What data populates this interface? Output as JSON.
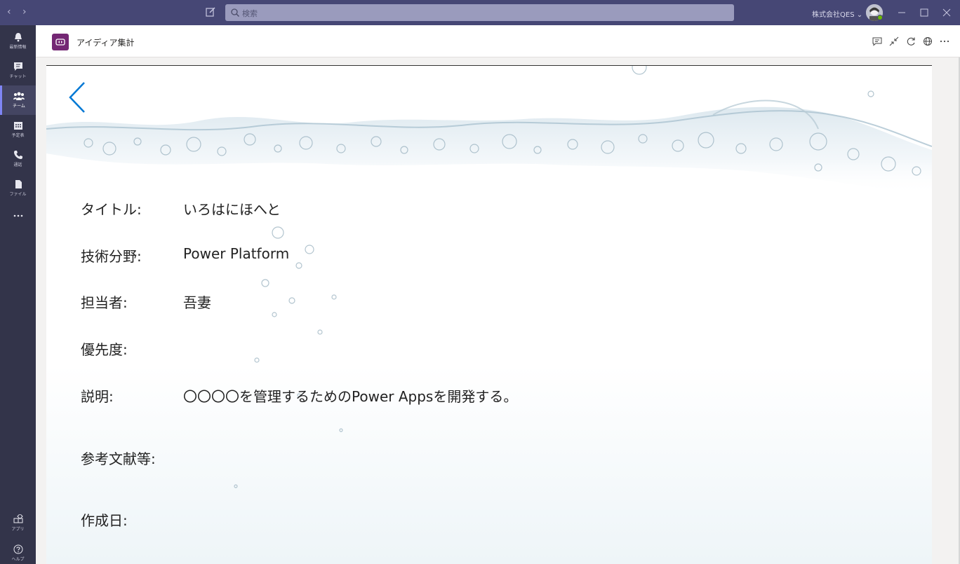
{
  "titlebar": {
    "search_placeholder": "検索",
    "org_name": "株式会社QES"
  },
  "rail": {
    "items": [
      {
        "label": "最新情報",
        "icon": "bell-icon"
      },
      {
        "label": "チャット",
        "icon": "chat-icon"
      },
      {
        "label": "チーム",
        "icon": "teams-icon",
        "active": true
      },
      {
        "label": "予定表",
        "icon": "calendar-icon"
      },
      {
        "label": "通話",
        "icon": "phone-icon"
      },
      {
        "label": "ファイル",
        "icon": "file-icon"
      },
      {
        "label": "アプリ",
        "icon": "apps-icon"
      },
      {
        "label": "ヘルプ",
        "icon": "help-icon"
      }
    ]
  },
  "app": {
    "title": "アイディア集計"
  },
  "detail": {
    "fields": [
      {
        "label": "タイトル:",
        "value": "いろはにほへと"
      },
      {
        "label": "技術分野:",
        "value": "Power Platform"
      },
      {
        "label": "担当者:",
        "value": "吾妻"
      },
      {
        "label": "優先度:",
        "value": ""
      },
      {
        "label": "説明:",
        "value": "〇〇〇〇を管理するためのPower Appsを開発する。"
      },
      {
        "label": "参考文献等:",
        "value": ""
      },
      {
        "label": "作成日:",
        "value": ""
      }
    ]
  },
  "colors": {
    "titlebar": "#464775",
    "rail": "#33344a",
    "accent": "#7f85f5",
    "back_arrow": "#0078d4",
    "app_logo": "#742774"
  }
}
